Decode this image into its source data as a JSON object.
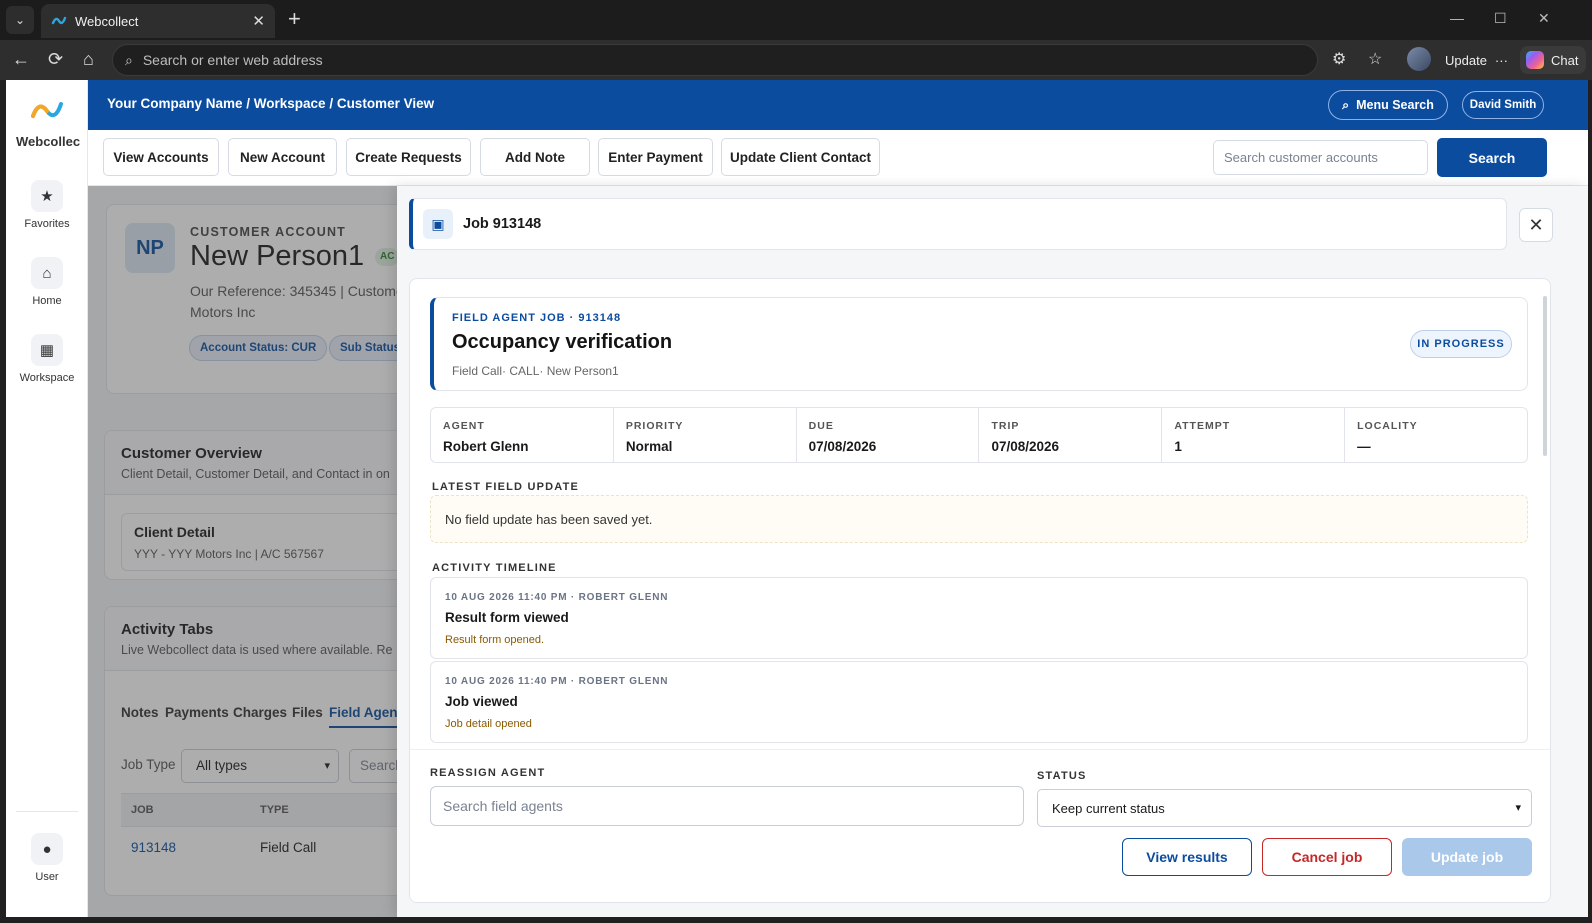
{
  "browser": {
    "tab_title": "Webcollect",
    "address_placeholder": "Search or enter web address",
    "update_label": "Update",
    "update_more": "···",
    "chat_label": "Chat"
  },
  "sidebar": {
    "brand": "Webcollec",
    "items": [
      {
        "label": "Favorites",
        "icon": "star-icon"
      },
      {
        "label": "Home",
        "icon": "home-icon"
      },
      {
        "label": "Workspace",
        "icon": "grid-icon"
      },
      {
        "label": "User",
        "icon": "user-icon"
      }
    ]
  },
  "header": {
    "breadcrumb": "Your Company Name / Workspace / Customer View",
    "menu_search": "Menu Search",
    "user": "David Smith"
  },
  "toolbar": {
    "buttons": [
      "View Accounts",
      "New Account",
      "Create Requests",
      "Add Note",
      "Enter Payment",
      "Update Client Contact"
    ],
    "search_placeholder": "Search customer accounts",
    "search_button": "Search"
  },
  "customer": {
    "initials": "NP",
    "kicker": "CUSTOMER ACCOUNT",
    "name": "New Person1",
    "badge": "AC",
    "ref_line": "Our Reference: 345345 | Custome",
    "ref_line2": "Motors Inc",
    "status_chip": "Account Status: CUR",
    "substatus_chip": "Sub Status"
  },
  "overview": {
    "title": "Customer Overview",
    "subtitle": "Client Detail, Customer Detail, and Contact in on",
    "client_detail_title": "Client Detail",
    "client_detail_value": "YYY - YYY Motors Inc | A/C 567567"
  },
  "activity": {
    "title": "Activity Tabs",
    "subtitle": "Live Webcollect data is used where available. Re",
    "tabs": [
      "Notes",
      "Payments",
      "Charges",
      "Files",
      "Field Agen"
    ],
    "job_type_label": "Job Type",
    "job_type_value": "All types",
    "search_placeholder": "Search",
    "col_job": "JOB",
    "col_type": "TYPE",
    "row_job": "913148",
    "row_type": "Field Call"
  },
  "drawer": {
    "title": "Job 913148",
    "kicker": "FIELD AGENT JOB · 913148",
    "job_title": "Occupancy verification",
    "job_sub": "Field Call· CALL· New Person1",
    "status": "IN PROGRESS",
    "meta": [
      {
        "label": "AGENT",
        "value": "Robert Glenn"
      },
      {
        "label": "PRIORITY",
        "value": "Normal"
      },
      {
        "label": "DUE",
        "value": "07/08/2026"
      },
      {
        "label": "TRIP",
        "value": "07/08/2026"
      },
      {
        "label": "ATTEMPT",
        "value": "1"
      },
      {
        "label": "LOCALITY",
        "value": "—"
      }
    ],
    "latest_label": "LATEST FIELD UPDATE",
    "latest_value": "No field update has been saved yet.",
    "timeline_label": "ACTIVITY TIMELINE",
    "timeline": [
      {
        "ts": "10 AUG 2026 11:40 PM · ROBERT GLENN",
        "title": "Result form viewed",
        "detail": "Result form opened."
      },
      {
        "ts": "10 AUG 2026 11:40 PM · ROBERT GLENN",
        "title": "Job viewed",
        "detail": "Job detail opened"
      }
    ],
    "reassign_label": "REASSIGN AGENT",
    "reassign_placeholder": "Search field agents",
    "status_label": "STATUS",
    "status_value": "Keep current status",
    "btn_view": "View results",
    "btn_cancel": "Cancel job",
    "btn_update": "Update job"
  },
  "colors": {
    "brand": "#0b4c9f",
    "danger": "#c62828",
    "disabled": "#a9c8ea"
  }
}
